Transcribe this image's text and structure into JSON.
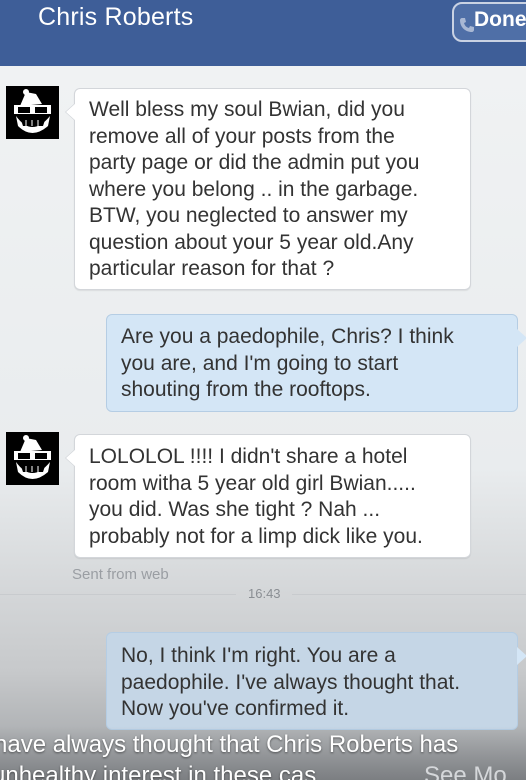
{
  "header": {
    "title": "Chris Roberts",
    "done_label": "Done",
    "phone_icon": "phone-icon",
    "bg_color": "#3e5e98"
  },
  "messages": [
    {
      "direction": "incoming",
      "text": "Well bless my soul Bwian, did you\nremove all of your posts from the\nparty page or did the admin put you\nwhere you belong .. in the garbage.\nBTW, you neglected to answer my\nquestion about your 5 year old.Any\nparticular reason for that ?"
    },
    {
      "direction": "outgoing",
      "text": "Are you a paedophile, Chris? I think\nyou are, and I'm going to start\nshouting from the rooftops."
    },
    {
      "direction": "incoming",
      "text": "LOLOLOL !!!!  I didn't share a hotel\nroom witha 5 year old girl Bwian.....\nyou did. Was she tight ? Nah ...\nprobably not for a limp dick like you."
    },
    {
      "direction": "outgoing",
      "text": "No, I think I'm right. You are a\npaedophile. I've always thought that.\nNow you've confirmed it."
    }
  ],
  "sent_from": "Sent from web",
  "timestamp": "16:43",
  "caption": {
    "line1": "have always thought that Chris Roberts has",
    "line2": "unhealthy interest in these cas",
    "see_more": "See Mo"
  }
}
